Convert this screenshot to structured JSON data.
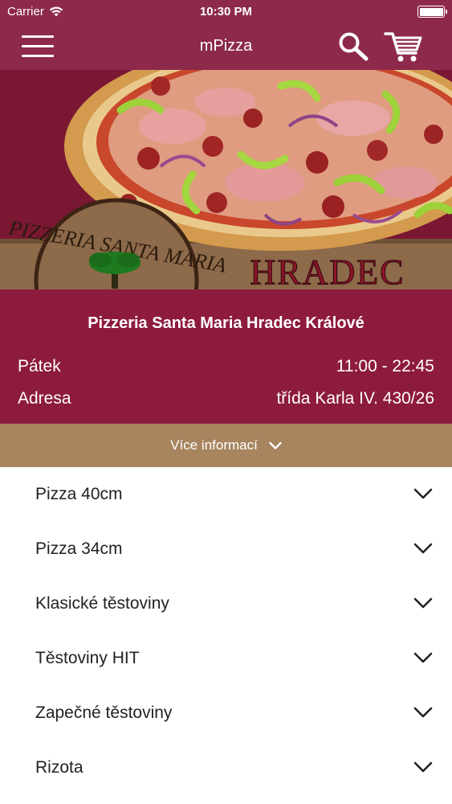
{
  "status_bar": {
    "carrier": "Carrier",
    "time": "10:30 PM"
  },
  "nav": {
    "title": "mPizza",
    "icons": [
      "menu-icon",
      "search-icon",
      "cart-icon"
    ]
  },
  "hero": {
    "logo_text": "PIZZERIA SANTA MARIA",
    "city_text": "HRADEC"
  },
  "restaurant": {
    "name": "Pizzeria Santa Maria Hradec Králové",
    "day_label": "Pátek",
    "hours": "11:00 - 22:45",
    "address_label": "Adresa",
    "address": "třída Karla IV. 430/26"
  },
  "more_info": {
    "label": "Více informací"
  },
  "categories": [
    {
      "label": "Pizza 40cm"
    },
    {
      "label": "Pizza 34cm"
    },
    {
      "label": "Klasické těstoviny"
    },
    {
      "label": "Těstoviny HIT"
    },
    {
      "label": "Zapečné těstoviny"
    },
    {
      "label": "Rizota"
    }
  ],
  "colors": {
    "header": "#8d2a4c",
    "info_panel": "#8d1b3d",
    "more_bar": "#a8845f",
    "list_text": "#222222"
  }
}
